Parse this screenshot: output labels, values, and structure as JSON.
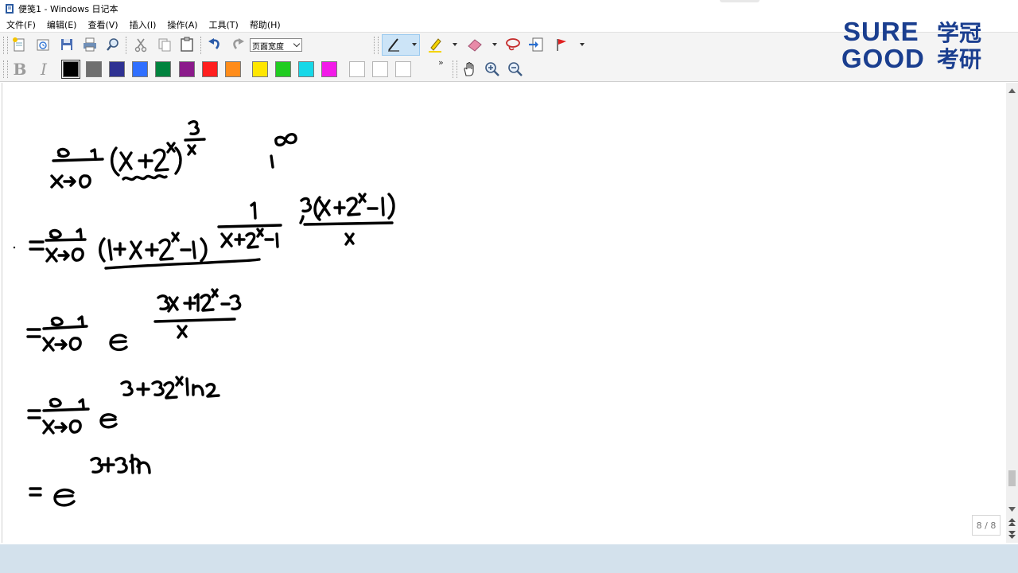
{
  "window": {
    "title": "便笺1 - Windows 日记本"
  },
  "menu": {
    "items": [
      "文件(F)",
      "编辑(E)",
      "查看(V)",
      "插入(I)",
      "操作(A)",
      "工具(T)",
      "帮助(H)"
    ]
  },
  "toolbar": {
    "width_select": {
      "value": "页面宽度"
    },
    "icons": [
      "new-note-icon",
      "open-icon",
      "save-icon",
      "print-icon",
      "find-icon",
      "cut-icon",
      "copy-icon",
      "paste-icon",
      "undo-icon",
      "redo-icon",
      "pen-icon",
      "highlighter-icon",
      "eraser-icon",
      "lasso-icon",
      "insert-space-icon",
      "flag-icon",
      "hand-icon",
      "zoom-in-icon",
      "zoom-out-icon"
    ],
    "format": {
      "bold": "B",
      "italic": "I",
      "overflow": "»"
    },
    "colors": [
      "#000000",
      "#6f6f6f",
      "#2e3192",
      "#2f6fff",
      "#00833e",
      "#8b1a8b",
      "#ff1f1f",
      "#ff8c1a",
      "#ffe600",
      "#21cc21",
      "#17d8e8",
      "#f21ae8",
      "#ffffff",
      "#ffffff",
      "#ffffff"
    ]
  },
  "logo": {
    "line1": "SURE",
    "line2": "GOOD",
    "cn1": "学冠",
    "cn2": "考研",
    "color": "#1a3e8f"
  },
  "page_indicator": "8 / 8"
}
